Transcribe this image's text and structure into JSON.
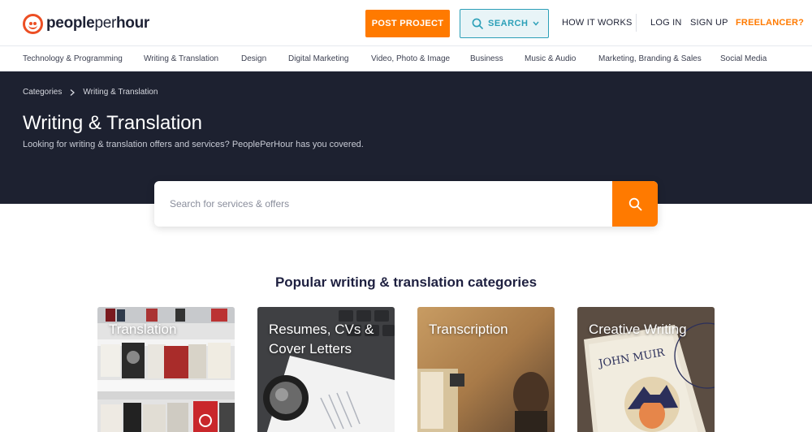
{
  "header": {
    "logo_part1": "people",
    "logo_part2": "per",
    "logo_part3": "hour",
    "post_project": "POST PROJECT",
    "search": "SEARCH",
    "how_it_works": "HOW IT WORKS",
    "log_in": "LOG IN",
    "sign_up": "SIGN UP",
    "freelancer": "FREELANCER?"
  },
  "categories": [
    "Technology & Programming",
    "Writing & Translation",
    "Design",
    "Digital Marketing",
    "Video, Photo & Image",
    "Business",
    "Music & Audio",
    "Marketing, Branding & Sales",
    "Social Media"
  ],
  "hero": {
    "breadcrumb_root": "Categories",
    "breadcrumb_current": "Writing & Translation",
    "title": "Writing & Translation",
    "subtitle": "Looking for writing & translation offers and services? PeoplePerHour has you covered."
  },
  "search": {
    "placeholder": "Search for services & offers"
  },
  "popular": {
    "title": "Popular writing & translation categories",
    "cards": [
      {
        "line1": "Translation",
        "line2": ""
      },
      {
        "line1": "Resumes, CVs &",
        "line2": "Cover Letters"
      },
      {
        "line1": "Transcription",
        "line2": ""
      },
      {
        "line1": "Creative Writing",
        "line2": ""
      }
    ],
    "book_title": "JOHN MUIR"
  },
  "colors": {
    "accent": "#ff7a00",
    "teal": "#2ca0b8",
    "hero_bg": "#1d2130",
    "brand_red": "#ec4f24"
  }
}
